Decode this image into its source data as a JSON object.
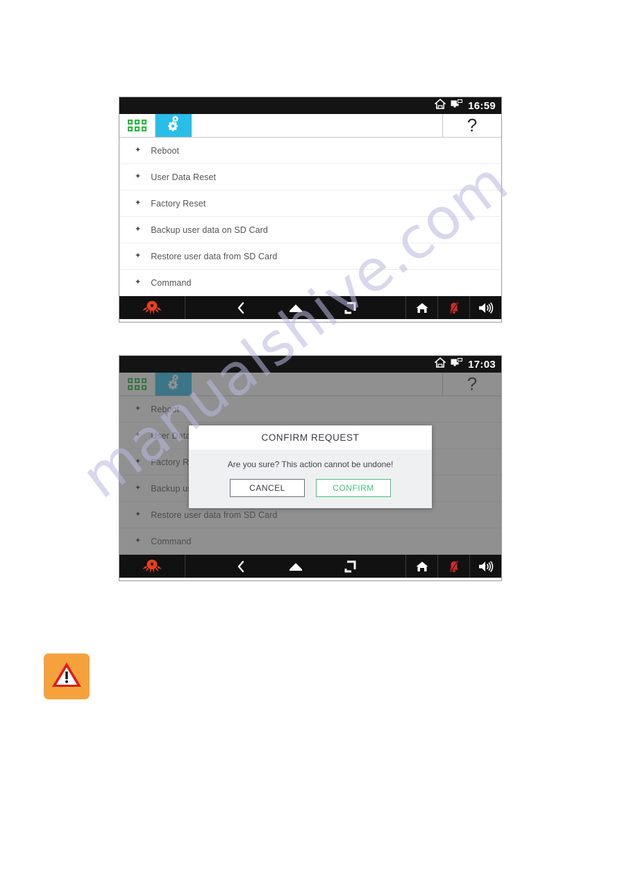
{
  "page": {
    "watermark_text": "manualshive.com"
  },
  "colors": {
    "tab_active": "#29bdea",
    "tab_active_dimmed": "#1a7f99",
    "grid_green": "#1fbb3d",
    "confirm_green": "#45c07e",
    "logo_red": "#e8401f",
    "bell_red": "#cf2b2b",
    "statusbar_black": "#141414",
    "navbar_black": "#111111",
    "warning_orange": "#f6a23c",
    "warning_triangle_red": "#e01b1b",
    "dialog_body_grey": "#eff0f2",
    "overlay_grey": "rgba(70,70,70,0.60)"
  },
  "screens": [
    {
      "id": "settings-list",
      "statusbar": {
        "clock": "16:59",
        "icons": [
          "home-icon",
          "remote-display-icon"
        ]
      },
      "tabbar": {
        "apps_tab": "apps-grid-icon",
        "settings_tab": "settings-gear-icon",
        "help_label": "?"
      },
      "menu_items": [
        {
          "label": "Reboot"
        },
        {
          "label": "User Data Reset"
        },
        {
          "label": "Factory Reset"
        },
        {
          "label": "Backup user data on SD Card"
        },
        {
          "label": "Restore user data from SD Card"
        },
        {
          "label": "Command"
        }
      ],
      "navbar": {
        "logo": "octopus-logo-icon",
        "buttons": [
          "back-icon",
          "home-icon",
          "recent-apps-icon",
          "home-outline-icon",
          "notifications-muted-icon",
          "volume-icon"
        ]
      },
      "dialog": null
    },
    {
      "id": "settings-list-confirm",
      "statusbar": {
        "clock": "17:03",
        "icons": [
          "home-icon",
          "remote-display-icon"
        ]
      },
      "tabbar": {
        "apps_tab": "apps-grid-icon",
        "settings_tab": "settings-gear-icon",
        "help_label": "?"
      },
      "menu_items": [
        {
          "label": "Reboot"
        },
        {
          "label": "User Data Reset"
        },
        {
          "label": "Factory Reset"
        },
        {
          "label": "Backup user data on SD Card"
        },
        {
          "label": "Restore user data from SD Card"
        },
        {
          "label": "Command"
        }
      ],
      "navbar": {
        "logo": "octopus-logo-icon",
        "buttons": [
          "back-icon",
          "home-icon",
          "recent-apps-icon",
          "home-outline-icon",
          "notifications-muted-icon",
          "volume-icon"
        ]
      },
      "dialog": {
        "title": "CONFIRM REQUEST",
        "message": "Are you sure? This action cannot be undone!",
        "cancel_label": "CANCEL",
        "confirm_label": "CONFIRM"
      }
    }
  ],
  "callout": {
    "icon": "warning-triangle-icon"
  }
}
